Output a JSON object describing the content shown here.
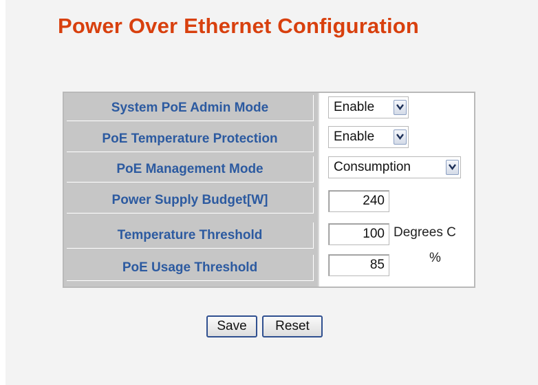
{
  "title": "Power Over Ethernet Configuration",
  "rows": [
    {
      "label": "System PoE Admin Mode",
      "value": "Enable"
    },
    {
      "label": "PoE Temperature Protection",
      "value": "Enable"
    },
    {
      "label": "PoE Management Mode",
      "value": "Consumption"
    },
    {
      "label": "Power Supply Budget[W]",
      "value": "240",
      "unit": ""
    },
    {
      "label": "Temperature Threshold",
      "value": "100",
      "unit": "Degrees C"
    },
    {
      "label": "PoE Usage Threshold",
      "value": "85",
      "unit": "%"
    }
  ],
  "buttons": {
    "save": "Save",
    "reset": "Reset"
  },
  "colors": {
    "title": "#d8400e",
    "label_text": "#2c5aa0",
    "label_bg": "#c6c6c6"
  }
}
